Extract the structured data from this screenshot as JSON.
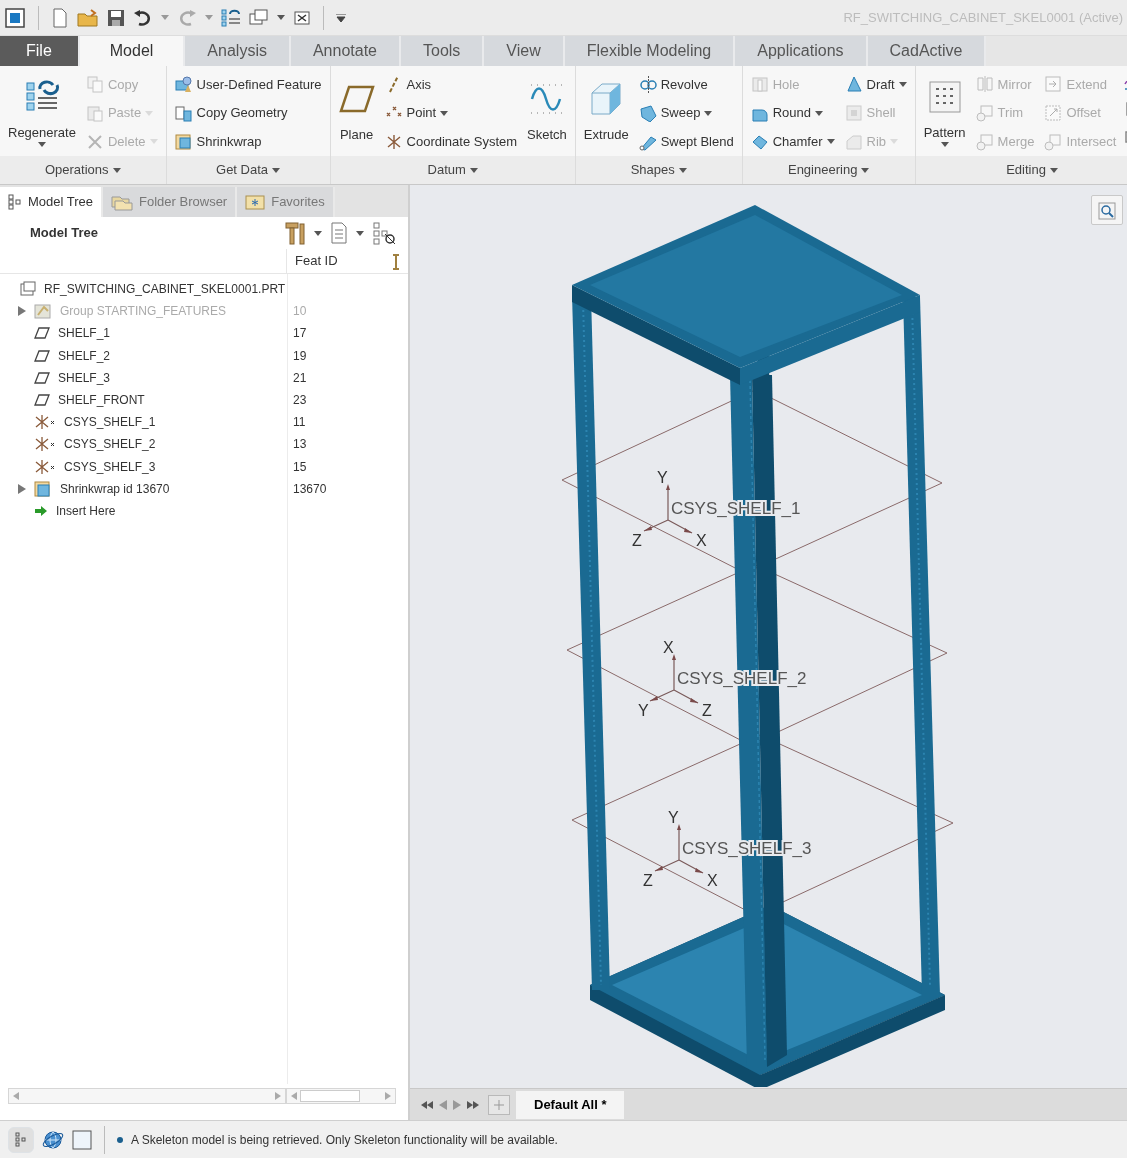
{
  "window": {
    "title": "RF_SWITCHING_CABINET_SKEL0001 (Active)"
  },
  "ribbon_tabs": [
    {
      "label": "File",
      "kind": "file",
      "selected": false
    },
    {
      "label": "Model",
      "kind": "tab",
      "selected": true
    },
    {
      "label": "Analysis",
      "kind": "tab",
      "selected": false
    },
    {
      "label": "Annotate",
      "kind": "tab",
      "selected": false
    },
    {
      "label": "Tools",
      "kind": "tab",
      "selected": false
    },
    {
      "label": "View",
      "kind": "tab",
      "selected": false
    },
    {
      "label": "Flexible Modeling",
      "kind": "tab",
      "selected": false
    },
    {
      "label": "Applications",
      "kind": "tab",
      "selected": false
    },
    {
      "label": "CadActive",
      "kind": "tab",
      "selected": false
    }
  ],
  "ribbon_groups": [
    {
      "label": "Operations",
      "items": [
        {
          "kind": "large",
          "label": "Regenerate",
          "dropdown": true,
          "disabled": false
        },
        {
          "kind": "stack",
          "items": [
            {
              "label": "Copy",
              "dropdown": false,
              "disabled": true
            },
            {
              "label": "Paste",
              "dropdown": true,
              "disabled": true
            },
            {
              "label": "Delete",
              "dropdown": true,
              "disabled": true
            }
          ]
        }
      ]
    },
    {
      "label": "Get Data",
      "items": [
        {
          "kind": "stack",
          "items": [
            {
              "label": "User-Defined Feature",
              "dropdown": false,
              "disabled": false
            },
            {
              "label": "Copy Geometry",
              "dropdown": false,
              "disabled": false
            },
            {
              "label": "Shrinkwrap",
              "dropdown": false,
              "disabled": false
            }
          ]
        }
      ]
    },
    {
      "label": "Datum",
      "items": [
        {
          "kind": "large",
          "label": "Plane",
          "dropdown": false,
          "disabled": false
        },
        {
          "kind": "stack",
          "items": [
            {
              "label": "Axis",
              "dropdown": false,
              "disabled": false
            },
            {
              "label": "Point",
              "dropdown": true,
              "disabled": false
            },
            {
              "label": "Coordinate System",
              "dropdown": false,
              "disabled": false
            }
          ]
        },
        {
          "kind": "large",
          "label": "Sketch",
          "dropdown": false,
          "disabled": false
        }
      ]
    },
    {
      "label": "Shapes",
      "items": [
        {
          "kind": "large",
          "label": "Extrude",
          "dropdown": false,
          "disabled": false
        },
        {
          "kind": "stack",
          "items": [
            {
              "label": "Revolve",
              "dropdown": false,
              "disabled": false
            },
            {
              "label": "Sweep",
              "dropdown": true,
              "disabled": false
            },
            {
              "label": "Swept Blend",
              "dropdown": false,
              "disabled": false
            }
          ]
        }
      ]
    },
    {
      "label": "Engineering",
      "items": [
        {
          "kind": "stack",
          "items": [
            {
              "label": "Hole",
              "dropdown": false,
              "disabled": true
            },
            {
              "label": "Round",
              "dropdown": true,
              "disabled": false
            },
            {
              "label": "Chamfer",
              "dropdown": true,
              "disabled": false
            }
          ]
        },
        {
          "kind": "stack",
          "items": [
            {
              "label": "Draft",
              "dropdown": true,
              "disabled": false
            },
            {
              "label": "Shell",
              "dropdown": false,
              "disabled": true
            },
            {
              "label": "Rib",
              "dropdown": true,
              "disabled": true
            }
          ]
        }
      ]
    },
    {
      "label": "Editing",
      "items": [
        {
          "kind": "large",
          "label": "Pattern",
          "dropdown": true,
          "disabled": false
        },
        {
          "kind": "stack",
          "items": [
            {
              "label": "Mirror",
              "dropdown": false,
              "disabled": true
            },
            {
              "label": "Trim",
              "dropdown": false,
              "disabled": true
            },
            {
              "label": "Merge",
              "dropdown": false,
              "disabled": true
            }
          ]
        },
        {
          "kind": "stack",
          "items": [
            {
              "label": "Extend",
              "dropdown": false,
              "disabled": true
            },
            {
              "label": "Offset",
              "dropdown": false,
              "disabled": true
            },
            {
              "label": "Intersect",
              "dropdown": false,
              "disabled": true
            }
          ]
        }
      ]
    }
  ],
  "model_tree": {
    "tabs": [
      {
        "label": "Model Tree",
        "selected": true
      },
      {
        "label": "Folder Browser",
        "selected": false
      },
      {
        "label": "Favorites",
        "selected": false
      }
    ],
    "title": "Model Tree",
    "columns": [
      "Feat ID"
    ],
    "items": [
      {
        "kind": "part",
        "label": "RF_SWITCHING_CABINET_SKEL0001.PRT",
        "children": [
          {
            "kind": "group",
            "label": "Group STARTING_FEATURES",
            "feat_id": "10",
            "expanded": false,
            "disabled": true
          },
          {
            "kind": "plane",
            "label": "SHELF_1",
            "feat_id": "17",
            "disabled": false
          },
          {
            "kind": "plane",
            "label": "SHELF_2",
            "feat_id": "19",
            "disabled": false
          },
          {
            "kind": "plane",
            "label": "SHELF_3",
            "feat_id": "21",
            "disabled": false
          },
          {
            "kind": "plane",
            "label": "SHELF_FRONT",
            "feat_id": "23",
            "disabled": false
          },
          {
            "kind": "csys",
            "label": "CSYS_SHELF_1",
            "feat_id": "11",
            "disabled": false
          },
          {
            "kind": "csys",
            "label": "CSYS_SHELF_2",
            "feat_id": "13",
            "disabled": false
          },
          {
            "kind": "csys",
            "label": "CSYS_SHELF_3",
            "feat_id": "15",
            "disabled": false
          },
          {
            "kind": "shrinkwrap",
            "label": "Shrinkwrap id 13670",
            "feat_id": "13670",
            "expanded": false,
            "disabled": false
          },
          {
            "kind": "insert",
            "label": "Insert Here",
            "disabled": false
          }
        ]
      }
    ]
  },
  "viewport": {
    "csys": [
      {
        "label": "CSYS_SHELF_1",
        "axes": [
          "Y",
          "Z",
          "X"
        ]
      },
      {
        "label": "CSYS_SHELF_2",
        "axes": [
          "X",
          "Y",
          "Z"
        ]
      },
      {
        "label": "CSYS_SHELF_3",
        "axes": [
          "Y",
          "Z",
          "X"
        ]
      }
    ],
    "view_tabs": [
      {
        "label": "Default All *",
        "selected": true
      }
    ]
  },
  "status_bar": {
    "message": "A Skeleton model is being retrieved. Only Skeleton functionality will be available."
  }
}
